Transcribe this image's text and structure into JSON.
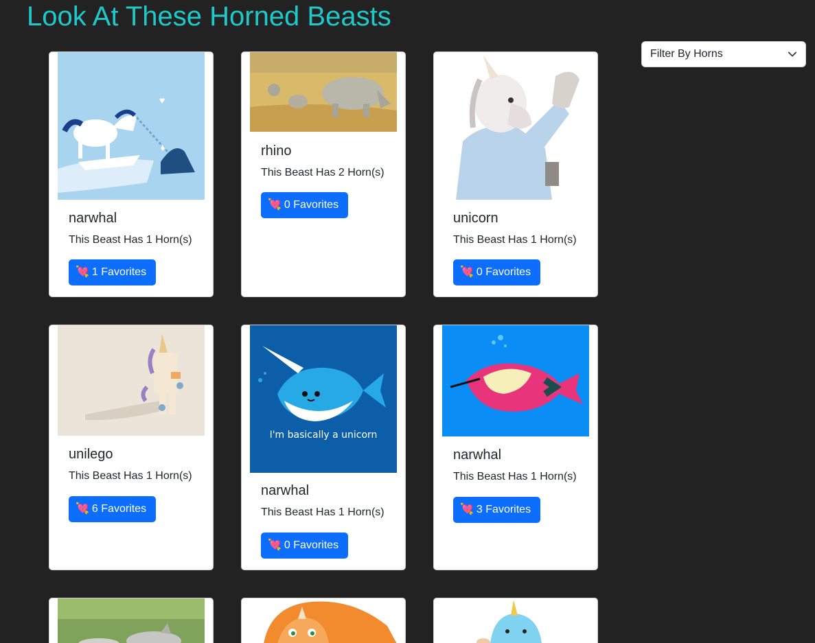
{
  "header": {
    "title": "Look At These Horned Beasts"
  },
  "filter": {
    "selected": "Filter By Horns",
    "icon": "chevron-down-icon"
  },
  "beasts": [
    {
      "name": "narwhal",
      "desc": "This Beast Has 1 Horn(s)",
      "fav": "1 Favorites"
    },
    {
      "name": "rhino",
      "desc": "This Beast Has 2 Horn(s)",
      "fav": "0 Favorites"
    },
    {
      "name": "unicorn",
      "desc": "This Beast Has 1 Horn(s)",
      "fav": "0 Favorites"
    },
    {
      "name": "unilego",
      "desc": "This Beast Has 1 Horn(s)",
      "fav": "6 Favorites"
    },
    {
      "name": "narwhal",
      "desc": "This Beast Has 1 Horn(s)",
      "fav": "0 Favorites",
      "image_text": "I'm basically a unicorn"
    },
    {
      "name": "narwhal",
      "desc": "This Beast Has 1 Horn(s)",
      "fav": "3 Favorites"
    }
  ],
  "favorite_icon": "💘",
  "colors": {
    "background": "#222222",
    "title": "#20c9c9",
    "button": "#0d6efd"
  }
}
